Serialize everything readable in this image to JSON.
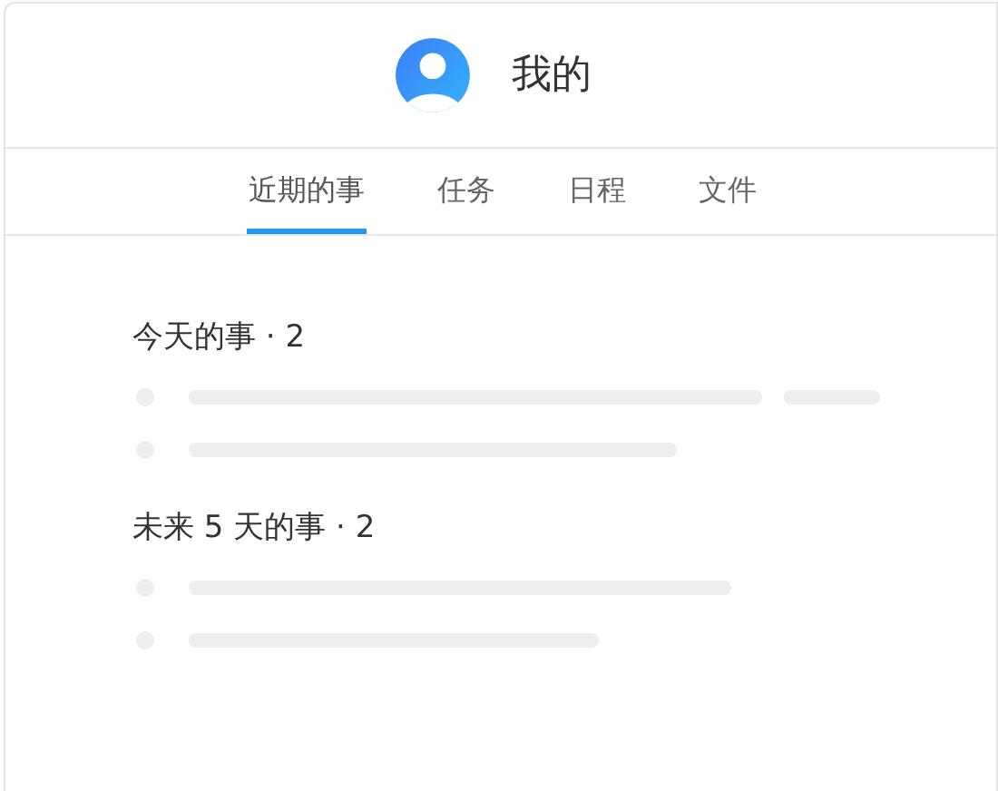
{
  "header": {
    "title": "我的"
  },
  "tabs": [
    {
      "label": "近期的事",
      "selected": true
    },
    {
      "label": "任务",
      "selected": false
    },
    {
      "label": "日程",
      "selected": false
    },
    {
      "label": "文件",
      "selected": false
    }
  ],
  "sections": [
    {
      "title": "今天的事 · 2",
      "rows": [
        {
          "kind": "skeleton"
        },
        {
          "kind": "skeleton"
        }
      ]
    },
    {
      "title": "未来 5 天的事 · 2",
      "rows": [
        {
          "kind": "skeleton"
        },
        {
          "kind": "skeleton"
        }
      ]
    }
  ]
}
